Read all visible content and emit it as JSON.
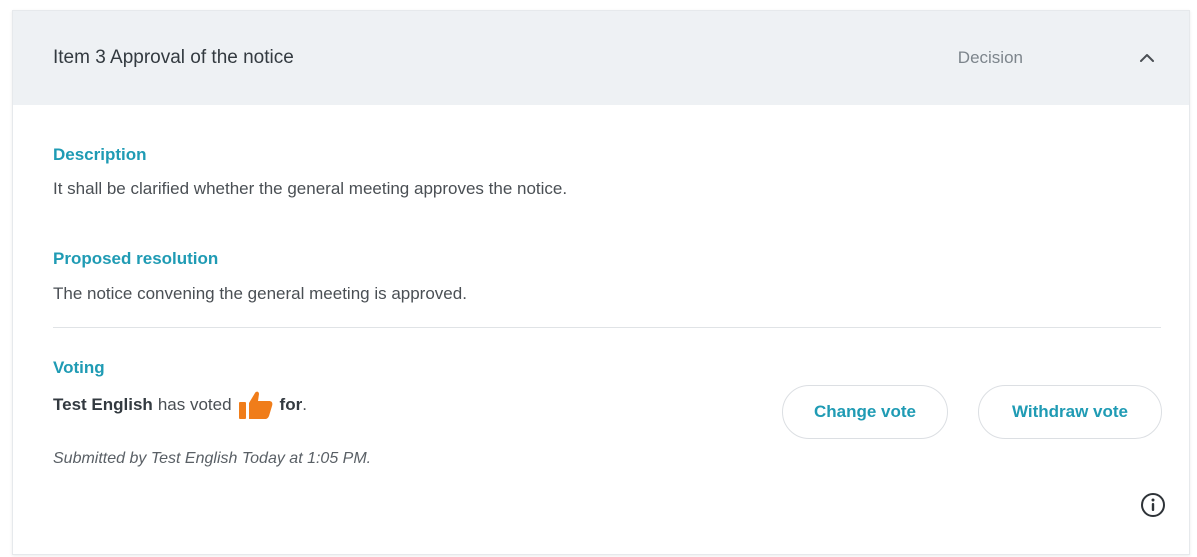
{
  "agenda_item": {
    "title": "Item 3 Approval of the notice",
    "type": "Decision",
    "collapse_icon": "chevron-up-icon"
  },
  "description": {
    "label": "Description",
    "text": "It shall be clarified whether the general meeting approves the notice."
  },
  "proposed_resolution": {
    "label": "Proposed resolution",
    "text": "The notice convening the general meeting is approved."
  },
  "voting": {
    "label": "Voting",
    "voter_name": "Test English",
    "verb": "has voted",
    "vote_icon": "thumbs-up-icon",
    "direction": "for",
    "period": ".",
    "submitted_text": "Submitted by Test English Today at 1:05 PM.",
    "change_button": "Change vote",
    "withdraw_button": "Withdraw vote",
    "info_icon": "info-icon"
  },
  "colors": {
    "accent": "#1f9bb4",
    "vote_for": "#f07d1a",
    "header_bg": "#eef1f4"
  }
}
